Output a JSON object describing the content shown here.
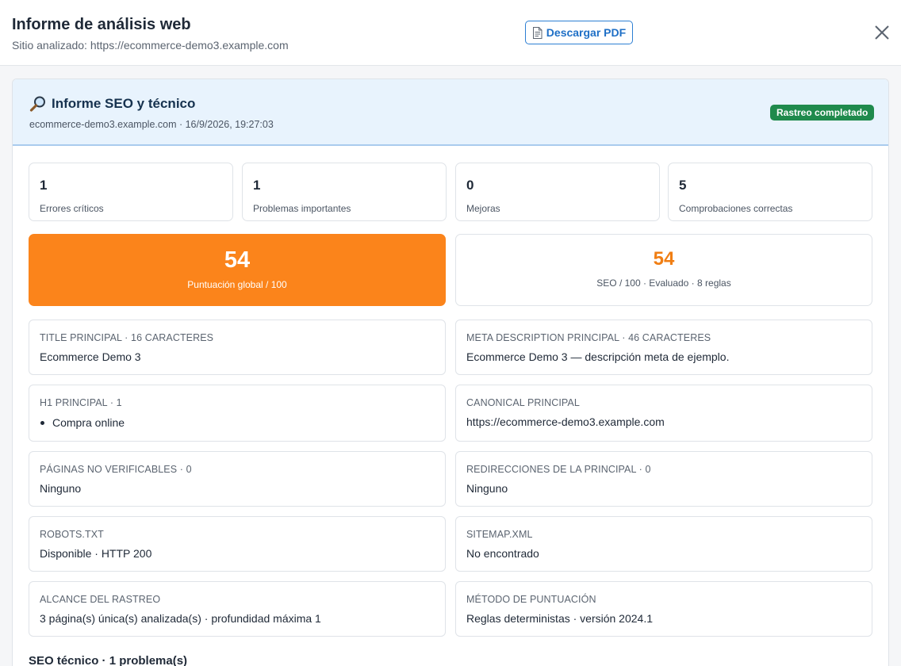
{
  "header": {
    "title": "Informe de análisis web",
    "subtitle": "Sitio analizado: https://ecommerce-demo3.example.com",
    "pdf_button": "Descargar PDF",
    "pdf_icon": "document-icon",
    "close_icon": "close-icon"
  },
  "report": {
    "title": "Informe SEO y técnico",
    "title_icon": "magnifier-icon",
    "meta": "ecommerce-demo3.example.com · 16/9/2026, 19:27:03",
    "status_badge": "Rastreo completado",
    "stats": [
      {
        "value": "1",
        "label": "Errores críticos"
      },
      {
        "value": "1",
        "label": "Problemas importantes"
      },
      {
        "value": "0",
        "label": "Mejoras"
      },
      {
        "value": "5",
        "label": "Comprobaciones correctas"
      }
    ],
    "global_score": {
      "value": "54",
      "label": "Puntuación global / 100"
    },
    "seo_score": {
      "value": "54",
      "label": "SEO / 100 · Evaluado · 8 reglas"
    },
    "cards": [
      {
        "label": "Title principal · 16 caracteres",
        "value": "Ecommerce Demo 3"
      },
      {
        "label": "Meta description principal · 46 caracteres",
        "value": "Ecommerce Demo 3 — descripción meta de ejemplo."
      },
      {
        "label": "H1 principal · 1",
        "items": [
          "Compra online"
        ]
      },
      {
        "label": "Canonical principal",
        "value": "https://ecommerce-demo3.example.com"
      },
      {
        "label": "Páginas no verificables · 0",
        "value": "Ninguno"
      },
      {
        "label": "Redirecciones de la principal · 0",
        "value": "Ninguno"
      },
      {
        "label": "robots.txt",
        "value": "Disponible · HTTP 200"
      },
      {
        "label": "sitemap.xml",
        "value": "No encontrado"
      },
      {
        "label": "Alcance del rastreo",
        "value": "3 página(s) única(s) analizada(s) · profundidad máxima 1"
      },
      {
        "label": "Método de puntuación",
        "value": "Reglas deterministas · versión 2024.1"
      }
    ],
    "section_title": "SEO técnico · 1 problema(s)"
  },
  "colors": {
    "accent_blue": "#2d7fd3",
    "score_orange": "#fb841b",
    "badge_green": "#1f8a4c",
    "header_bg": "#e8f3fd"
  }
}
